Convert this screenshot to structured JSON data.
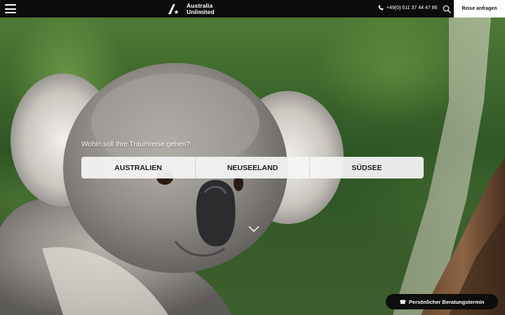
{
  "header": {
    "menu_icon": "hamburger-icon",
    "logo_icon": "australia-unlimited-logo",
    "logo_line1": "Australia",
    "logo_line2": "Unlimited",
    "phone_icon": "phone-icon",
    "phone_number": "+49(0) 511 37 44 47 86",
    "search_icon": "search-icon",
    "request_label": "Reise anfragen"
  },
  "hero": {
    "question": "Wohin soll Ihre Traumreise gehen?",
    "destinations": [
      "AUSTRALIEN",
      "NEUSEELAND",
      "SÜDSEE"
    ],
    "scroll_icon": "chevron-down-icon"
  },
  "consult_button": {
    "icon": "phone-icon",
    "icon_glyph": "☎",
    "label": "Persönlicher Beratungstermin"
  },
  "colors": {
    "header_bg": "#0c0c0c",
    "button_dark": "#0d0d0d",
    "picker_bg": "#f5f5f5"
  }
}
